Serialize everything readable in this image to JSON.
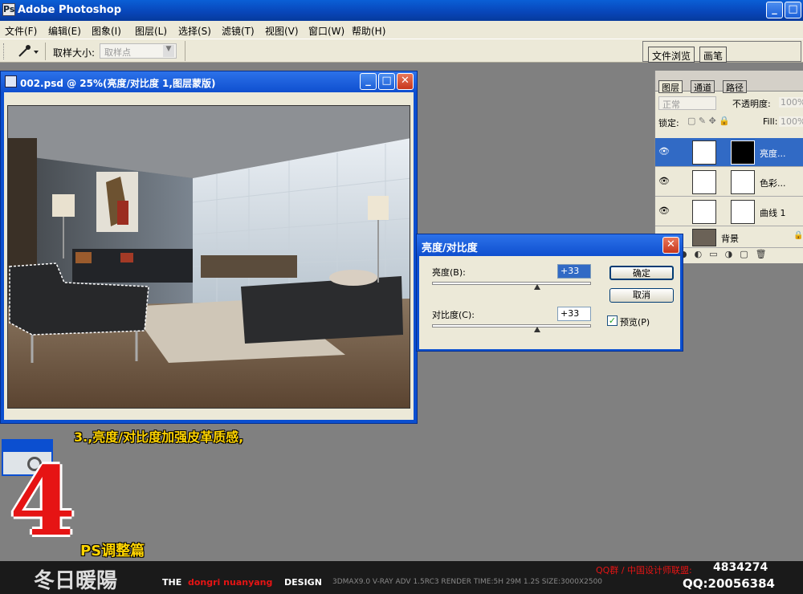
{
  "app": {
    "title": "Adobe Photoshop",
    "icon": "photoshop-app-icon"
  },
  "menu": [
    "文件(F)",
    "编辑(E)",
    "图象(I)",
    "图层(L)",
    "选择(S)",
    "滤镜(T)",
    "视图(V)",
    "窗口(W)",
    "帮助(H)"
  ],
  "options": {
    "tool_icon": "eyedropper-icon",
    "sample_label": "取样大小:",
    "sample_value": "取样点"
  },
  "top_tabs": [
    "文件浏览",
    "画笔"
  ],
  "document": {
    "title": "002.psd @ 25%(亮度/对比度 1,图层蒙版)"
  },
  "layers_panel": {
    "tabs": [
      "图层",
      "通道",
      "路径"
    ],
    "blend_mode": "正常",
    "opacity_label": "不透明度:",
    "opacity_value": "100%",
    "lock_label": "锁定:",
    "fill_label": "Fill:",
    "fill_value": "100%",
    "layers": [
      {
        "name": "亮度...",
        "selected": true
      },
      {
        "name": "色彩...",
        "selected": false
      },
      {
        "name": "曲线 1",
        "selected": false
      },
      {
        "name": "背景",
        "selected": false
      }
    ]
  },
  "dialog": {
    "title": "亮度/对比度",
    "brightness_label": "亮度(B):",
    "brightness_value": "+33",
    "contrast_label": "对比度(C):",
    "contrast_value": "+33",
    "ok": "确定",
    "cancel": "取消",
    "preview_label": "预览(P)"
  },
  "caption": "3.,亮度/对比度加强皮革质感,",
  "big_number": "4",
  "subtitle": "PS调整篇",
  "footer": {
    "logo": "冬日暖陽",
    "design_prefix": "THE",
    "design_name": "dongri nuanyang",
    "design_suffix": "DESIGN",
    "specs": "3DMAX9.0 V-RAY ADV 1.5RC3 RENDER TIME:5H 29M 1.2S SIZE:3000X2500",
    "qq_group_label": "QQ群 / 中国设计师联盟:",
    "qq_group_value": "4834274",
    "qq": "QQ:20056384"
  },
  "colors": {
    "accent": "#0b4fd0",
    "caption": "#ffd400",
    "big_number": "#e61414",
    "footer_red": "#e61414"
  }
}
